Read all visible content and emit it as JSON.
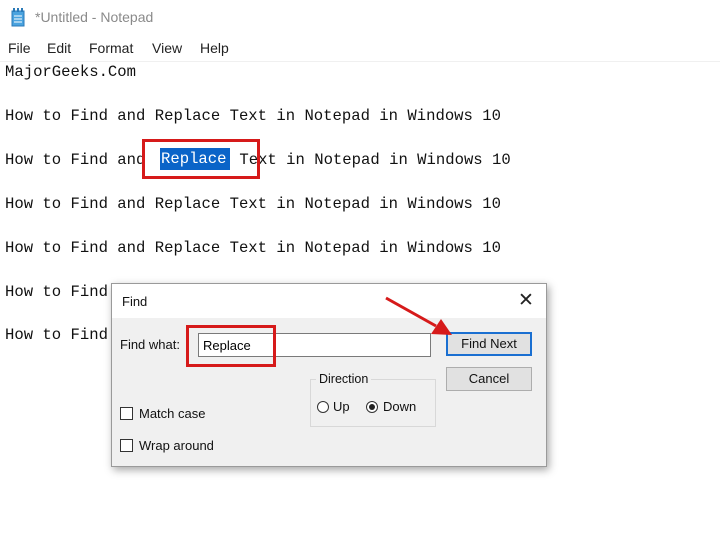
{
  "window": {
    "title": "*Untitled - Notepad"
  },
  "menu": {
    "items": [
      "File",
      "Edit",
      "Format",
      "View",
      "Help"
    ]
  },
  "editor": {
    "lines": [
      "MajorGeeks.Com",
      "How to Find and Replace Text in Notepad in Windows 10",
      "How to Find and ",
      "How to Find and Replace Text in Notepad in Windows 10",
      "How to Find and Replace Text in Notepad in Windows 10",
      "How to Find",
      "How to Find"
    ],
    "selected_word": "Replace",
    "after_selection": " Text in Notepad in Windows 10"
  },
  "find_dialog": {
    "title": "Find",
    "close_glyph": "✕",
    "find_what_label": "Find what:",
    "find_what_value": "Replace",
    "find_next_label": "Find Next",
    "cancel_label": "Cancel",
    "direction_label": "Direction",
    "up_label": "Up",
    "down_label": "Down",
    "direction_selected": "Down",
    "match_case_label": "Match case",
    "wrap_around_label": "Wrap around",
    "match_case_checked": false,
    "wrap_around_checked": false
  },
  "colors": {
    "highlight_box": "#d61a1a",
    "selection": "#0a64c8",
    "default_button_border": "#1a6fd1"
  },
  "icons": {
    "app": "notepad-icon",
    "close": "close-icon",
    "arrow": "red-arrow-icon"
  }
}
